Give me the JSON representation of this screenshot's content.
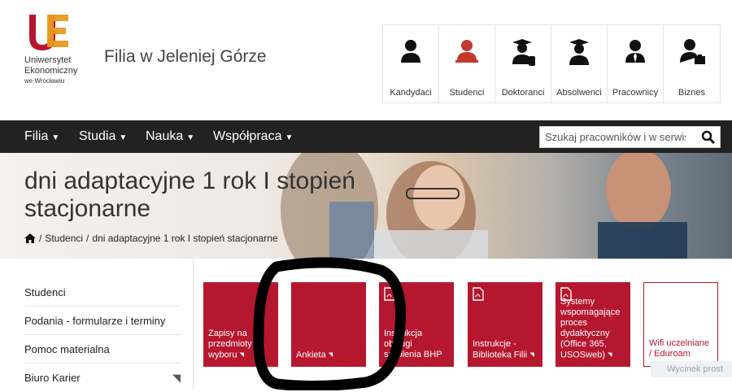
{
  "brand": {
    "logo_mark": "UE",
    "logo_line1": "Uniwersytet",
    "logo_line2": "Ekonomiczny",
    "logo_line3": "we Wrocławiu",
    "site_title": "Filia w Jeleniej Górze",
    "colors": {
      "accent": "#b5172e",
      "navbar": "#222222"
    }
  },
  "audience": [
    {
      "label": "Kandydaci",
      "icon": "person-icon"
    },
    {
      "label": "Studenci",
      "icon": "student-icon"
    },
    {
      "label": "Doktoranci",
      "icon": "graduate-diploma-icon"
    },
    {
      "label": "Absolwenci",
      "icon": "graduate-icon"
    },
    {
      "label": "Pracownicy",
      "icon": "employee-icon"
    },
    {
      "label": "Biznes",
      "icon": "business-icon"
    }
  ],
  "nav": {
    "items": [
      "Filia",
      "Studia",
      "Nauka",
      "Współpraca"
    ],
    "search_placeholder": "Szukaj pracowników i w serwisie"
  },
  "hero": {
    "title": "dni adaptacyjne 1 rok I stopień stacjonarne",
    "breadcrumb": [
      "Studenci",
      "dni adaptacyjne 1 rok I stopień stacjonarne"
    ]
  },
  "sidebar": {
    "items": [
      "Studenci",
      "Podania - formularze i terminy",
      "Pomoc materialna",
      "Biuro Karier"
    ]
  },
  "tiles": [
    {
      "text": "Zapisy na przedmioty do wyboru",
      "icon": ""
    },
    {
      "text": "Ankieta",
      "icon": ""
    },
    {
      "text": "Instrukcja obsługi szkolenia BHP",
      "icon": "pdf-icon"
    },
    {
      "text": "Instrukcje - Biblioteka Filii",
      "icon": "pdf-icon"
    },
    {
      "text": "Systemy wspomagające proces dydaktyczny (Office 365, USOSweb)",
      "icon": "pdf-icon"
    },
    {
      "text": "Wifi uczelniane / Eduroam",
      "icon": ""
    }
  ],
  "watermark": "Wycinek prost"
}
